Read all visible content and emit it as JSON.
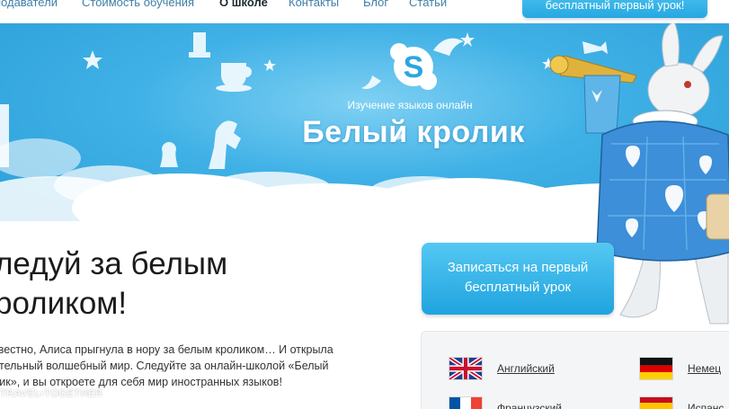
{
  "nav": {
    "items": [
      {
        "label": "подаватели"
      },
      {
        "label": "Стоимость обучения"
      },
      {
        "label": "О школе",
        "active": true
      },
      {
        "label": "Контакты"
      },
      {
        "label": "Блог"
      },
      {
        "label": "Статьи"
      }
    ],
    "cta_label": "бесплатный первый урок!"
  },
  "hero": {
    "subtitle": "Изучение языков онлайн",
    "title": "Белый кролик",
    "logo_icon": "skype-logo-icon"
  },
  "main": {
    "heading_line1": "ледуй за белым",
    "heading_line2": "роликом!",
    "intro_lines": [
      "звестно, Алиса прыгнула в нору за белым кроликом… И открыла",
      "ительный волшебный мир. Следуйте за онлайн-школой «Белый",
      "лик», и вы откроете для себя мир иностранных языков!"
    ],
    "cta_line1": "Записаться на первый",
    "cta_line2": "бесплатный урок"
  },
  "languages": [
    {
      "label": "Английский",
      "flag": "uk-flag-icon"
    },
    {
      "label": "Немец",
      "flag": "germany-flag-icon"
    },
    {
      "label": "Французский",
      "flag": "france-flag-icon"
    },
    {
      "label": "Испанс",
      "flag": "spain-flag-icon"
    }
  ],
  "watermark": "TRAVEL•TOGETHER",
  "colors": {
    "accent": "#25a8e2",
    "hero_blue": "#3fb1e6",
    "nav_link": "#3e7fa8"
  }
}
